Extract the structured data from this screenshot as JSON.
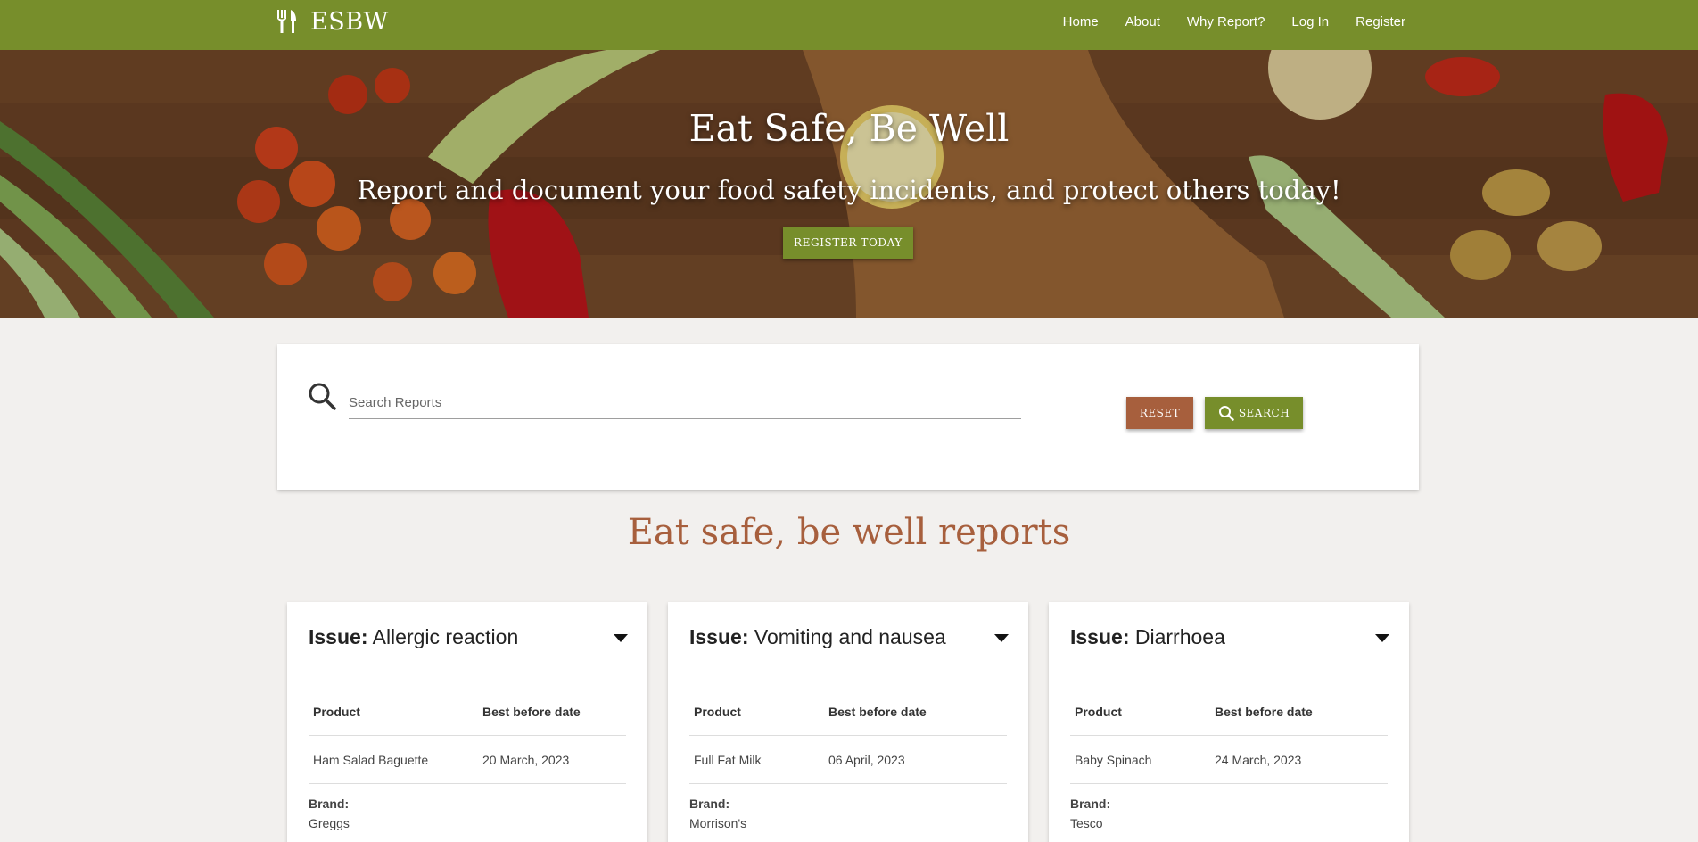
{
  "nav": {
    "brand": "ESBW",
    "links": [
      "Home",
      "About",
      "Why Report?",
      "Log In",
      "Register"
    ]
  },
  "hero": {
    "title": "Eat Safe, Be Well",
    "subtitle": "Report and document your food safety incidents, and protect others today!",
    "cta": "REGISTER TODAY"
  },
  "search": {
    "placeholder": "Search Reports",
    "reset_label": "RESET",
    "search_label": "SEARCH"
  },
  "reports": {
    "title": "Eat safe, be well reports",
    "issue_label": "Issue:",
    "product_header": "Product",
    "date_header": "Best before date",
    "brand_label": "Brand:",
    "items": [
      {
        "issue": "Allergic reaction",
        "product": "Ham Salad Baguette",
        "best_before": "20 March, 2023",
        "brand": "Greggs"
      },
      {
        "issue": "Vomiting and nausea",
        "product": "Full Fat Milk",
        "best_before": "06 April, 2023",
        "brand": "Morrison's"
      },
      {
        "issue": "Diarrhoea",
        "product": "Baby Spinach",
        "best_before": "24 March, 2023",
        "brand": "Tesco"
      }
    ]
  },
  "colors": {
    "primary": "#778e2b",
    "accent": "#a75f3d",
    "background": "#f2f0ee"
  },
  "icons": {
    "brand": "fork-knife-icon",
    "search": "search-icon",
    "dropdown": "caret-down-icon"
  }
}
